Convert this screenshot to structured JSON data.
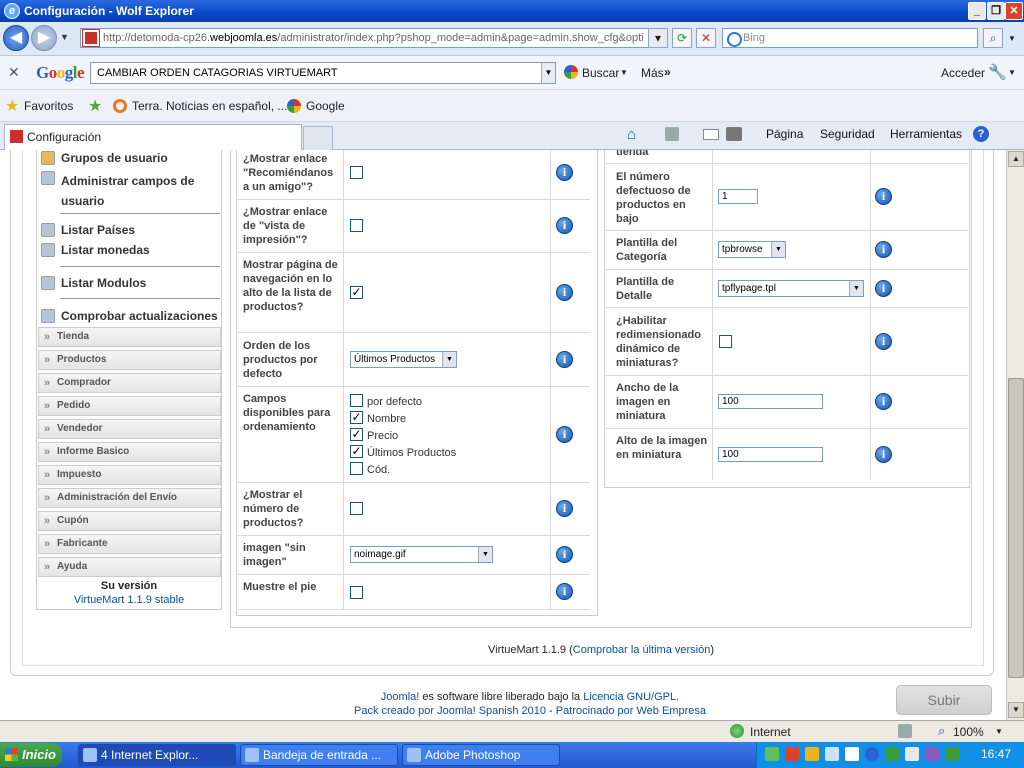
{
  "window": {
    "title": "Configuración - Wolf Explorer"
  },
  "address": {
    "url_prefix": "http://detomoda-cp26.",
    "url_domain": "webjoomla.es",
    "url_suffix": "/administrator/index.php?pshop_mode=admin&page=admin.show_cfg&opti",
    "search_placeholder": "Bing"
  },
  "google": {
    "logo": "Google",
    "search_value": "CAMBIAR ORDEN CATAGORIAS VIRTUEMART",
    "buscar": "Buscar",
    "mas": "Más",
    "acceder": "Acceder"
  },
  "favorites": {
    "label": "Favoritos",
    "items": [
      "Terra. Noticias en español, ...",
      "Google"
    ]
  },
  "tabs": {
    "active": "Configuración"
  },
  "commands": {
    "pagina": "Página",
    "seguridad": "Seguridad",
    "herramientas": "Herramientas"
  },
  "sidebar": {
    "links": [
      "Grupos de usuario",
      "Administrar campos de usuario",
      "Listar Países",
      "Listar monedas",
      "Listar Modulos",
      "Comprobar actualizaciones"
    ],
    "sections": [
      "Tienda",
      "Productos",
      "Comprador",
      "Pedido",
      "Vendedor",
      "Informe Basico",
      "Impuesto",
      "Administración del Envío",
      "Cupón",
      "Fabricante",
      "Ayuda"
    ],
    "version_title": "Su versión",
    "version_value": "VirtueMart 1.1.9 stable"
  },
  "left_config": {
    "recomiendanos": "¿Mostrar enlace \"Recomiéndanos a un amigo\"?",
    "vista_impresion": "¿Mostrar enlace de \"vista de impresión\"?",
    "pagina_nav": "Mostrar página de navegación en lo alto de la lista de productos?",
    "orden_defecto": "Orden de los productos por defecto",
    "orden_defecto_value": "Últimos Productos",
    "campos_ordenamiento": "Campos disponibles para ordenamiento",
    "campos_options": [
      "por defecto",
      "Nombre",
      "Precio",
      "Últimos Productos",
      "Cód."
    ],
    "mostrar_numero": "¿Mostrar el número de productos?",
    "imagen_sin": "imagen \"sin imagen\"",
    "imagen_sin_value": "noimage.gif",
    "muestre_pie": "Muestre el pie"
  },
  "right_config": {
    "top_partial": "tienda",
    "numero_defectuoso": "El número defectuoso de productos en bajo",
    "numero_defectuoso_value": "1",
    "plantilla_categoria": "Plantilla del Categoría",
    "plantilla_categoria_value": "tpbrowse",
    "plantilla_detalle": "Plantilla de Detalle",
    "plantilla_detalle_value": "tpflypage.tpl",
    "redimensionado": "¿Habilitar redimensionado dinámico de miniaturas?",
    "ancho": "Ancho de la imagen en miniatura",
    "ancho_value": "100",
    "alto": "Alto de la imagen en miniatura",
    "alto_value": "100"
  },
  "footer": {
    "vm_version": "VirtueMart 1.1.9",
    "check_link": "Comprobar la última versión",
    "joomla": "Joomla!",
    "joomla_text": " es software libre liberado bajo la ",
    "license": "Licencia GNU/GPL.",
    "pack": "Pack creado por Joomla! Spanish 2010",
    "sep": " - ",
    "sponsor": "Patrocinado por Web Empresa",
    "submit": "Subir"
  },
  "status": {
    "zone": "Internet",
    "zoom": "100%"
  },
  "taskbar": {
    "start": "Inicio",
    "tasks": [
      "4 Internet Explor...",
      "Bandeja de entrada ...",
      "Adobe Photoshop"
    ],
    "clock": "16:47"
  }
}
